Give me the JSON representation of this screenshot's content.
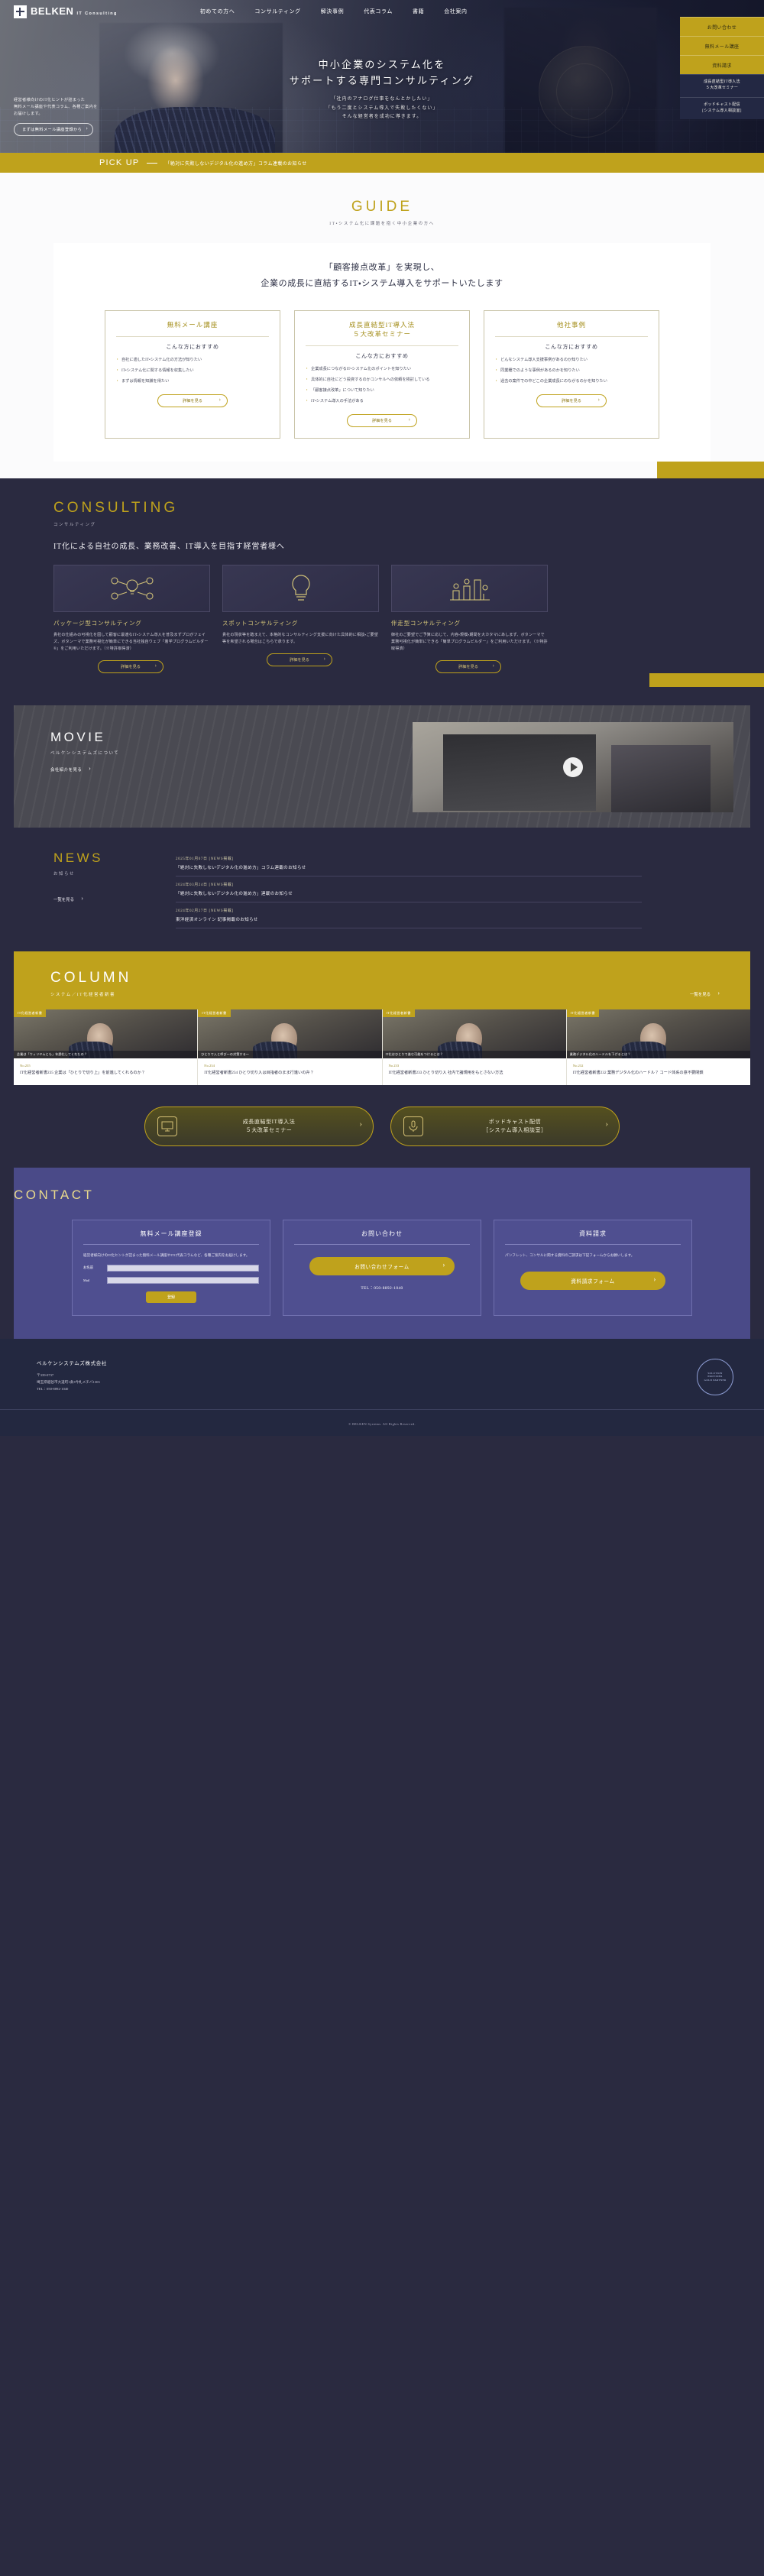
{
  "header": {
    "logo_name": "BELKEN",
    "logo_sub": "IT Consulting",
    "nav": [
      {
        "label": "初めての方へ"
      },
      {
        "label": "コンサルティング"
      },
      {
        "label": "解決事例"
      },
      {
        "label": "代表コラム"
      },
      {
        "label": "書籍"
      },
      {
        "label": "会社案内"
      }
    ]
  },
  "rail": [
    {
      "label": "お問い合わせ",
      "style": "gold"
    },
    {
      "label": "無料メール講座",
      "style": "gold"
    },
    {
      "label": "資料請求",
      "style": "gold"
    },
    {
      "label": "成長直結型IT導入法\n５大改革セミナー",
      "style": "navy"
    },
    {
      "label": "ポッドキャスト配信\n[システム導入相談室]",
      "style": "navy"
    }
  ],
  "hero": {
    "line1": "中小企業のシステム化を",
    "line2": "サポートする専門コンサルティング",
    "sub1": "「社内のアナログ仕事をなんとかしたい」",
    "sub2": "「もう二度とシステム導入で失敗したくない」",
    "sub3": "そんな経営者を成功に導きます。",
    "note1": "経営者様向けのIT化ヒントが詰まった",
    "note2": "無料メール講座や代表コラム、各種ご案内を",
    "note3": "お届けします。",
    "button": "まずは無料メール講座登録から"
  },
  "pickup": {
    "label": "PICK UP",
    "text": "「絶対に失敗しないデジタル化の進め方」コラム連載のお知らせ"
  },
  "guide": {
    "title": "GUIDE",
    "subtitle": "IT・システム化に課題を抱く中小企業の方へ",
    "lead1": "「顧客接点改革」を実現し、",
    "lead2": "企業の成長に直結するIT・システム導入をサポートいたします",
    "cards": [
      {
        "title": "無料メール講座",
        "subtitle": "こんな方におすすめ",
        "items": [
          "自社に適したIT・システム化の方法が知りたい",
          "IT・システム化に関する情報を収集したい",
          "まずは情報を知識を得たい"
        ],
        "button": "詳細を見る"
      },
      {
        "title": "成長直結型IT導入法\n５大改革セミナー",
        "subtitle": "こんな方におすすめ",
        "items": [
          "企業成長につながるIT・システム化のポイントを知りたい",
          "具体的に自社にどう投資するのかコンサルへの依頼を検討している",
          "「顧客接点改革」について知りたい",
          "IT・システム導入の手法がある"
        ],
        "button": "詳細を見る"
      },
      {
        "title": "他社事例",
        "subtitle": "こんな方におすすめ",
        "items": [
          "どんなシステム導入支援事例があるのか知りたい",
          "同業種でのような事例があるのかを知りたい",
          "過去の案件での中どこの企業成長にのながるのかを知りたい"
        ],
        "button": "詳細を見る"
      }
    ]
  },
  "consulting": {
    "title": "CONSULTING",
    "subtitle": "コンサルティング",
    "lead": "IT化による自社の成長、業務改善、IT導入を目指す経営者様へ",
    "cards": [
      {
        "icon": "lightbulb-network-icon",
        "title": "パッケージ型コンサルティング",
        "text": "貴社の仕組みの可視化を図して顧客に最適なIT・システム導入を普及まずプロがフェイズ、ボタンーマで業務可視化が簡単にできる当社独自ウェブ「着学プログラムビルダー®」をご利用いただけます。（※特許取得済）",
        "button": "詳細を見る"
      },
      {
        "icon": "bulb-icon",
        "title": "スポットコンサルティング",
        "text": "貴社の現状等を踏まえて、本格的なコンサルティング支援に向けた具体的に相談・ご要望等を希望される場合はこちらで承ります。",
        "button": "詳細を見る"
      },
      {
        "icon": "chart-people-icon",
        "title": "伴走型コンサルティング",
        "text": "御社のご要望でご予算に応じて、内容・規模・期間を大カタマにあしまず、ボタンーマで業務可視化が簡単にできる「簡単プログラムビルダー」をご利用いただけます。（※特許取得済）",
        "button": "詳細を見る"
      }
    ]
  },
  "movie": {
    "title": "MOVIE",
    "subtitle": "ベルケンシステムズについて",
    "button": "会社紹介を見る"
  },
  "news": {
    "title": "NEWS",
    "subtitle": "お知らせ",
    "all_label": "一覧を見る",
    "items": [
      {
        "date": "2025年01月07日 [NEWS掲載]",
        "title": "「絶対に失敗しないデジタル化の進め方」コラム連載のお知らせ"
      },
      {
        "date": "2024年03月24日 [NEWS掲載]",
        "title": "「絶対に失敗しないデジタル化の進め方」連載のお知らせ"
      },
      {
        "date": "2024年02月27日 [NEWS掲載]",
        "title": "東洋経済オンライン 記事掲載のお知らせ"
      }
    ]
  },
  "column": {
    "title": "COLUMN",
    "subtitle": "システム／IT化経営者新書",
    "all_label": "一覧を見る",
    "items": [
      {
        "badge": "IT化経営者新書",
        "caption": "企業は「ウィリヤムとも」年齢化してくれたの？",
        "no": "No.235",
        "title": "IT化経営者新書235 企業は「ひとりで切り上」を前進してくれるのか？"
      },
      {
        "badge": "IT化経営者新書",
        "caption": "ひとりで人と呼び〜の対策する〜",
        "no": "No.234",
        "title": "IT化経営者新書234 ひとり切り入は目指者のまま行進いの弁？"
      },
      {
        "badge": "IT化経営者新書",
        "caption": "IT化はひとりで進む可能をつけるには？",
        "no": "No.233",
        "title": "IT化経営者新書233 ひとり切り入 社内で諸規用をもとさない方法"
      },
      {
        "badge": "IT化経営者新書",
        "caption": "業務デジタル化のハードルを下げるとは？",
        "no": "No.232",
        "title": "IT化経営者新書232 業務デジタル化のハードル？ コード体系の意不要閉鎖"
      }
    ]
  },
  "promo": [
    {
      "icon": "seminar-icon",
      "label": "成長直結型IT導入法\n５大改革セミナー"
    },
    {
      "icon": "podcast-icon",
      "label": "ポッドキャスト配信\n［システム導入相談室］"
    }
  ],
  "contact": {
    "title": "CONTACT",
    "boxes": [
      {
        "name": "mail-course",
        "title": "無料メール講座登録",
        "text": "経営者様向けのIT化ヒントが詰まった無料メール講座やITC代表コラムなど、各種ご案内をお届けします。",
        "fields": [
          {
            "label": "お名前",
            "value": ""
          },
          {
            "label": "Mail",
            "value": ""
          }
        ],
        "button": "登録"
      },
      {
        "name": "inquiry",
        "title": "お問い合わせ",
        "button": "お問い合わせフォーム",
        "tel": "TEL：050-8892-1040"
      },
      {
        "name": "document-request",
        "title": "資料請求",
        "text": "パンフレット、コンサルに関する資料のご請求は下記フォームからお願いします。",
        "button": "資料請求フォーム"
      }
    ]
  },
  "footer": {
    "company": "ベルケンシステムズ株式会社",
    "zip": "〒339-0737",
    "address": "埼玉県越谷市大道町1条3今札メチバ1303",
    "tel": "TEL：050-8892-1040",
    "seal": "SOLUTION\nPROVIDER\nGOLD PARTNER",
    "copyright": "© BELKEN Systems. All Rights Reserved."
  }
}
